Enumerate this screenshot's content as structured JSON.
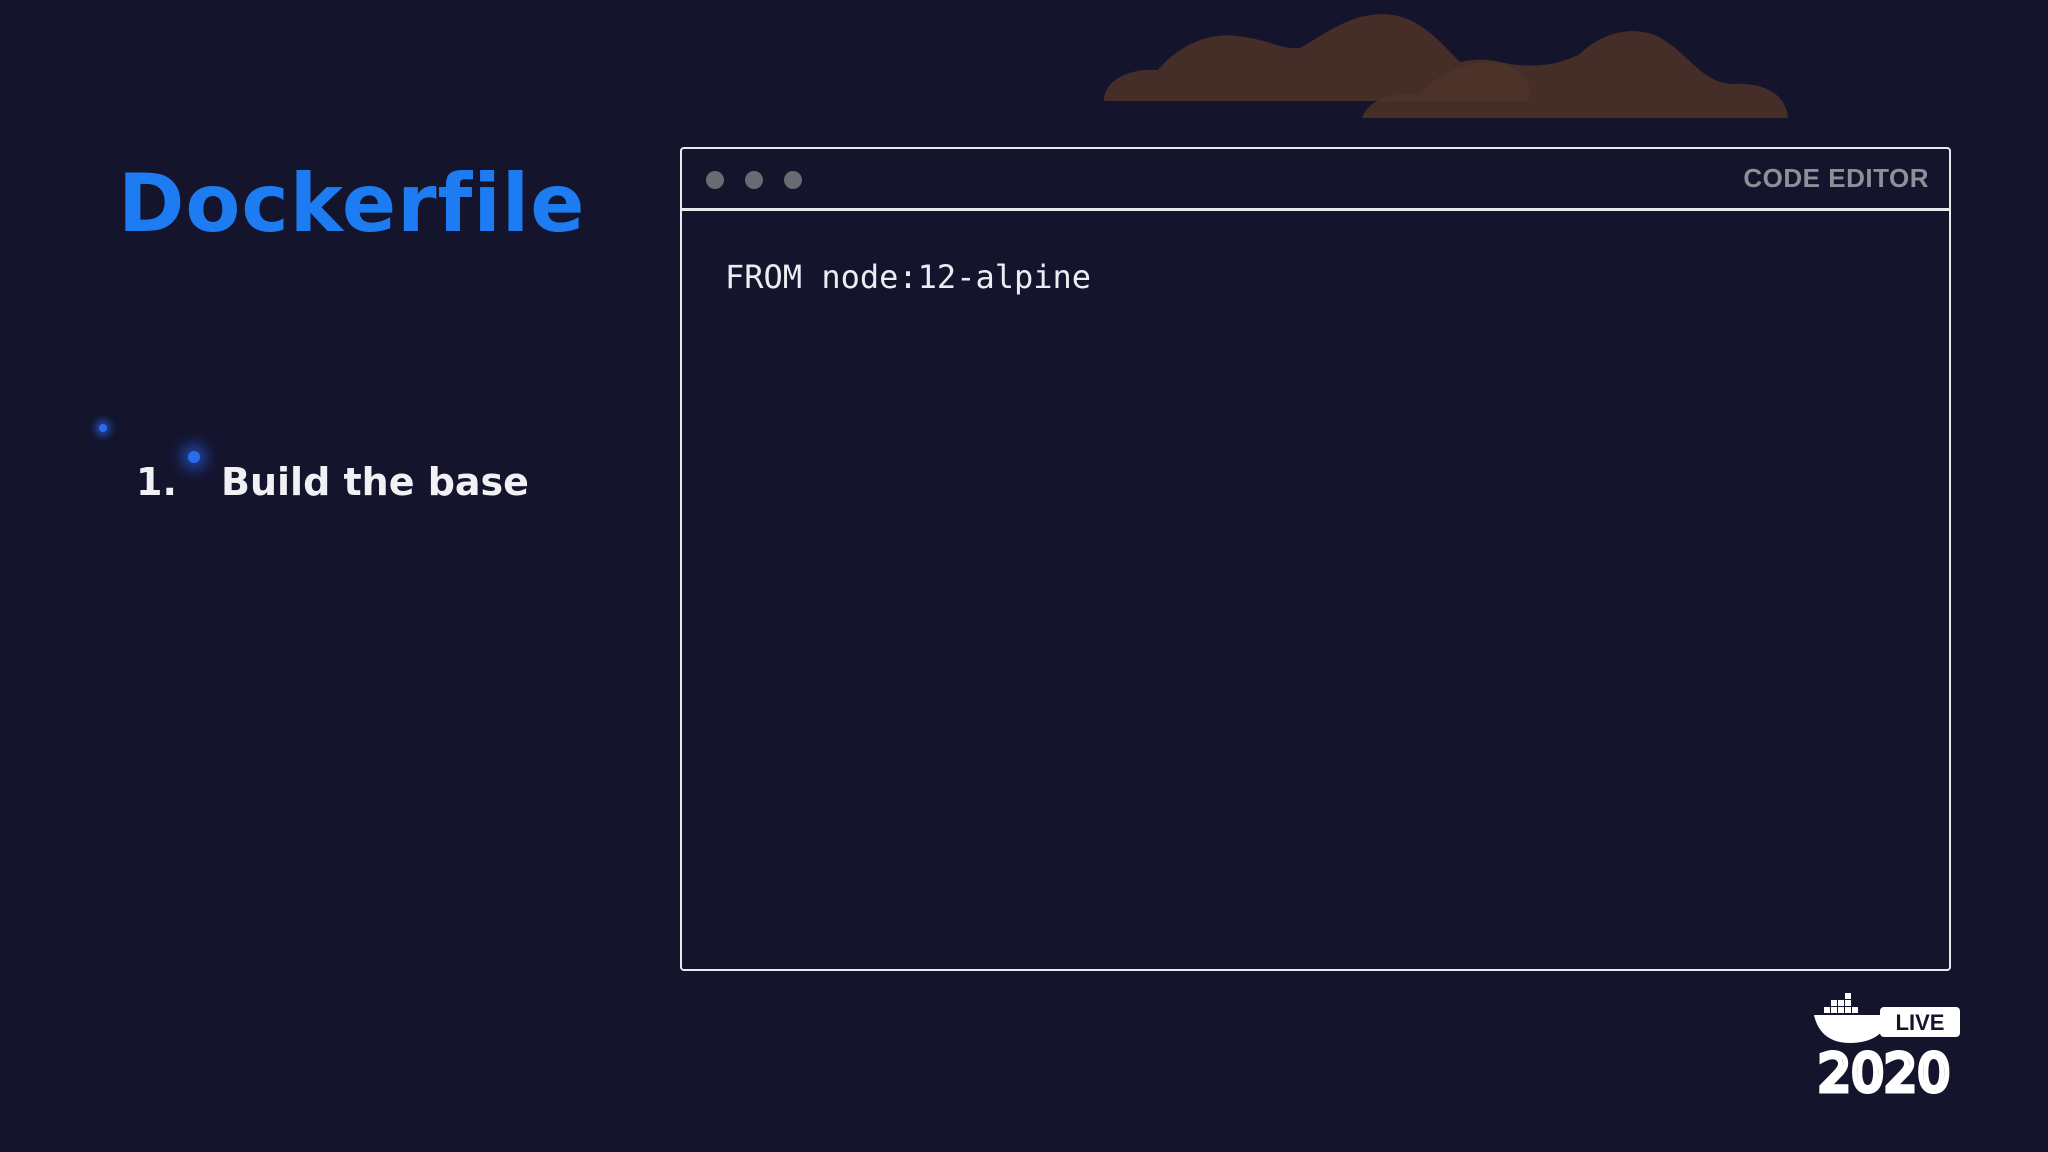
{
  "slide": {
    "title": "Dockerfile",
    "steps": [
      {
        "number": "1.",
        "label": "Build the base"
      }
    ]
  },
  "editor": {
    "label": "CODE EDITOR",
    "code": "FROM node:12-alpine"
  },
  "logo": {
    "badge": "LIVE",
    "year": "2020"
  },
  "colors": {
    "background": "#14142d",
    "title": "#1d7cf2",
    "cloud": "#5a3c2e"
  },
  "icons": {
    "window-dots": "window-dots-icon",
    "logo": "docker-whale-icon"
  }
}
